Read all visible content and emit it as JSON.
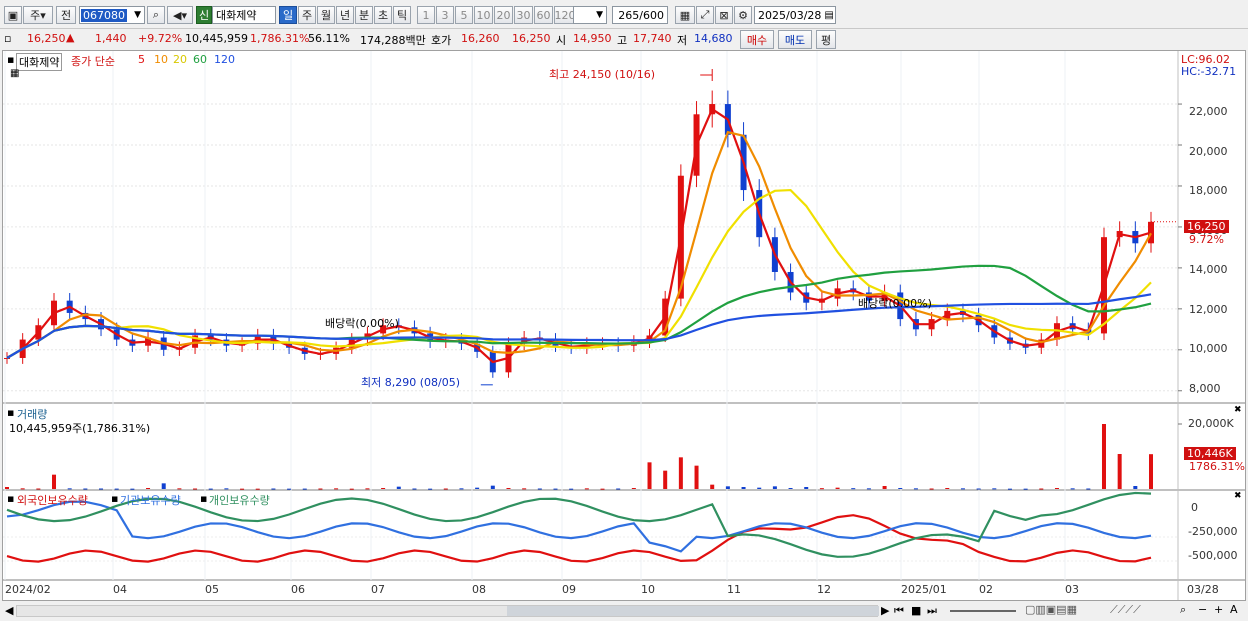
{
  "toolbar": {
    "period_type": "주",
    "prev_label": "전",
    "code": "067080",
    "stock_badge": "신",
    "stock_name": "대화제약",
    "periods": [
      "일",
      "주",
      "월",
      "년",
      "분",
      "초",
      "틱"
    ],
    "selected_period": "일",
    "minutes": [
      "1",
      "3",
      "5",
      "10",
      "20",
      "30",
      "60",
      "120"
    ],
    "count": "265",
    "count_total": "/600",
    "date": "2025/03/28"
  },
  "quote": {
    "price": "16,250",
    "change": "1,440",
    "change_pct": "+9.72%",
    "volume": "10,445,959",
    "volume_ratio": "1,786.31%",
    "turnover": "56.11%",
    "amount": "174,288백만",
    "bid_label": "호가",
    "bid": "16,260",
    "ask": "16,250",
    "open_label": "시",
    "open": "14,950",
    "high_label": "고",
    "high": "17,740",
    "low_label": "저",
    "low": "14,680",
    "buy_label": "매수",
    "sell_label": "매도",
    "avg_label": "평"
  },
  "price_panel": {
    "title": "대화제약",
    "ma_label": "종가 단순",
    "ma_periods": [
      "5",
      "10",
      "20",
      "60",
      "120"
    ],
    "lc": "LC:96.02",
    "hc": "HC:-32.71",
    "high_note": "최고 24,150 (10/16)",
    "low_note": "최저 8,290 (08/05)",
    "div_note1": "배당락(0.00%)",
    "div_note2": "배당락(0.00%)",
    "current_price": "16,250",
    "current_pct": "9.72%",
    "yticks": [
      "22,000",
      "20,000",
      "18,000",
      "16,000",
      "14,000",
      "12,000",
      "10,000",
      "8,000"
    ]
  },
  "volume_panel": {
    "title": "거래량",
    "value": "10,445,959주(1,786.31%)",
    "ytick": "20,000K",
    "current": "10,446K",
    "current_pct": "1786.31%"
  },
  "holding_panel": {
    "legend": [
      "외국인보유수량",
      "기관보유수량",
      "개인보유수량"
    ],
    "yticks": [
      "0",
      "-250,000",
      "-500,000"
    ]
  },
  "xaxis": {
    "labels": [
      "2024/02",
      "04",
      "05",
      "06",
      "07",
      "08",
      "09",
      "10",
      "11",
      "12",
      "2025/01",
      "02",
      "03",
      "03/28"
    ]
  },
  "colors": {
    "up": "#e01010",
    "down": "#1040d0",
    "ma5": "#e01010",
    "ma10": "#f08c00",
    "ma20": "#f0e000",
    "ma60": "#20a040",
    "ma120": "#2050e0",
    "foreign": "#e01010",
    "inst": "#3070e0",
    "retail": "#309060"
  },
  "chart_data": {
    "type": "candlestick",
    "ylim": [
      7500,
      24200
    ],
    "dates": [
      "2024/02",
      "04",
      "05",
      "06",
      "07",
      "08",
      "09",
      "10",
      "11",
      "12",
      "2025/01",
      "02",
      "03"
    ],
    "close": [
      9600,
      10500,
      11200,
      12400,
      11800,
      11500,
      11000,
      10500,
      10200,
      10600,
      10000,
      10100,
      10700,
      10500,
      10200,
      10300,
      10700,
      10300,
      10100,
      9800,
      9800,
      10100,
      10500,
      10800,
      11200,
      11100,
      10800,
      10400,
      10500,
      10300,
      9900,
      8900,
      10300,
      10600,
      10500,
      10200,
      10100,
      10300,
      10300,
      10200,
      10400,
      10700,
      12500,
      18500,
      21500,
      22000,
      20500,
      17800,
      15500,
      13800,
      12800,
      12300,
      12500,
      13000,
      12800,
      12400,
      12800,
      11500,
      11000,
      11500,
      11900,
      11700,
      11200,
      10600,
      10300,
      10100,
      10500,
      11300,
      11000,
      10800,
      15500,
      15800,
      15200,
      16250
    ],
    "volume_k": [
      600,
      200,
      150,
      4300,
      200,
      150,
      150,
      120,
      100,
      300,
      1700,
      200,
      150,
      120,
      200,
      100,
      100,
      150,
      100,
      120,
      150,
      200,
      100,
      200,
      300,
      700,
      150,
      100,
      150,
      200,
      400,
      1000,
      300,
      200,
      150,
      120,
      100,
      200,
      100,
      150,
      300,
      8000,
      5500,
      9500,
      7000,
      1300,
      800,
      600,
      400,
      800,
      300,
      600,
      250,
      400,
      250,
      200,
      900,
      300,
      200,
      150,
      300,
      200,
      150,
      200,
      100,
      100,
      150,
      300,
      200,
      150,
      19500,
      10500,
      900,
      10446
    ]
  }
}
